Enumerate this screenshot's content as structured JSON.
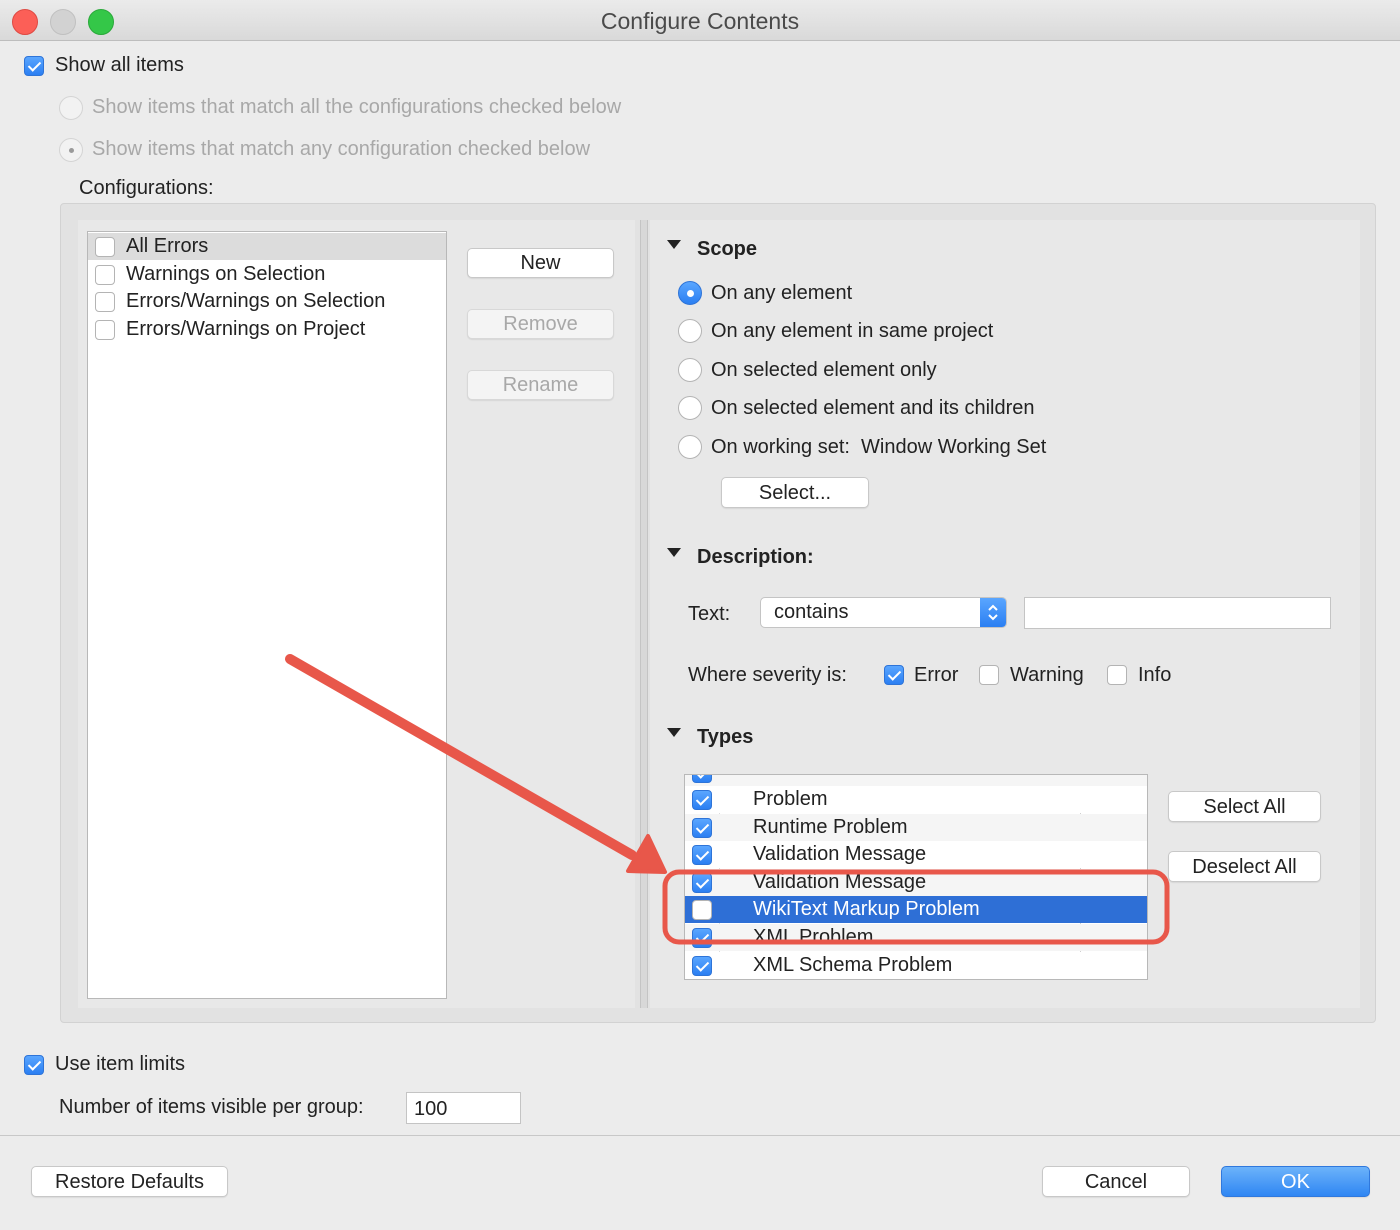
{
  "window": {
    "title": "Configure Contents"
  },
  "top": {
    "show_all_items": "Show all items",
    "match_all": "Show items that match all the configurations checked below",
    "match_any": "Show items that match any configuration checked below",
    "configurations_label": "Configurations:"
  },
  "configurations": [
    {
      "label": "All Errors",
      "checked": false
    },
    {
      "label": "Warnings on Selection",
      "checked": false
    },
    {
      "label": "Errors/Warnings on Selection",
      "checked": false
    },
    {
      "label": "Errors/Warnings on Project",
      "checked": false
    }
  ],
  "config_buttons": {
    "new": "New",
    "remove": "Remove",
    "rename": "Rename"
  },
  "scope": {
    "heading": "Scope",
    "options": [
      "On any element",
      "On any element in same project",
      "On selected element only",
      "On selected element and its children",
      "On working set:  Window Working Set"
    ],
    "selected_index": 0,
    "select_button": "Select..."
  },
  "description": {
    "heading": "Description:",
    "text_label": "Text:",
    "text_mode": "contains",
    "text_value": "",
    "severity_label": "Where severity is:",
    "severities": [
      {
        "label": "Error",
        "checked": true
      },
      {
        "label": "Warning",
        "checked": false
      },
      {
        "label": "Info",
        "checked": false
      }
    ]
  },
  "types": {
    "heading": "Types",
    "items": [
      {
        "label": "Problem",
        "checked": true,
        "selected": false
      },
      {
        "label": "Runtime Problem",
        "checked": true,
        "selected": false
      },
      {
        "label": "Validation Message",
        "checked": true,
        "selected": false
      },
      {
        "label": "Validation Message",
        "checked": true,
        "selected": false
      },
      {
        "label": "WikiText Markup Problem",
        "checked": false,
        "selected": true
      },
      {
        "label": "XML Problem",
        "checked": true,
        "selected": false
      },
      {
        "label": "XML Schema Problem",
        "checked": true,
        "selected": false
      }
    ],
    "select_all": "Select All",
    "deselect_all": "Deselect All"
  },
  "limits": {
    "use_item_limits": "Use item limits",
    "items_per_group_label": "Number of items visible per group:",
    "items_per_group_value": "100"
  },
  "footer": {
    "restore_defaults": "Restore Defaults",
    "cancel": "Cancel",
    "ok": "OK"
  },
  "colors": {
    "accent": "#2f86f3",
    "selection": "#2e6fd6",
    "annotation": "#e8574a"
  },
  "icons": {
    "disclosure": "disclosure-triangle-icon",
    "stepper": "up-down-stepper-icon"
  }
}
